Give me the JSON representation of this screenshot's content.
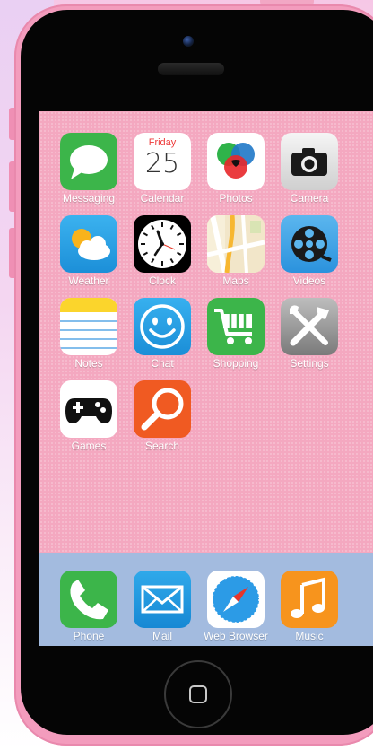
{
  "apps": [
    {
      "label": "Messaging",
      "icon": "message-bubble-icon",
      "color": "#3cb54a"
    },
    {
      "label": "Calendar",
      "icon": "calendar-icon",
      "color": "#ffffff",
      "day": "Friday",
      "date": "25"
    },
    {
      "label": "Photos",
      "icon": "photos-icon",
      "color": "#ffffff"
    },
    {
      "label": "Camera",
      "icon": "camera-icon",
      "color": "#d9d9d9"
    },
    {
      "label": "Weather",
      "icon": "weather-icon",
      "color": "#2aa6e8"
    },
    {
      "label": "Clock",
      "icon": "clock-icon",
      "color": "#000000"
    },
    {
      "label": "Maps",
      "icon": "map-icon",
      "color": "#f3e7c8"
    },
    {
      "label": "Videos",
      "icon": "film-reel-icon",
      "color": "#43a6e9"
    },
    {
      "label": "Notes",
      "icon": "notes-icon",
      "color": "#ffffff"
    },
    {
      "label": "Chat",
      "icon": "smiley-icon",
      "color": "#2aa6e8"
    },
    {
      "label": "Shopping",
      "icon": "shopping-cart-icon",
      "color": "#3cb54a"
    },
    {
      "label": "Settings",
      "icon": "tools-icon",
      "color": "#9a9a9a"
    },
    {
      "label": "Games",
      "icon": "gamepad-icon",
      "color": "#ffffff"
    },
    {
      "label": "Search",
      "icon": "magnifier-icon",
      "color": "#f05a22"
    }
  ],
  "dock": [
    {
      "label": "Phone",
      "icon": "phone-handset-icon",
      "color": "#3cb54a"
    },
    {
      "label": "Mail",
      "icon": "envelope-icon",
      "color": "#1f9fe0"
    },
    {
      "label": "Web Browser",
      "icon": "compass-icon",
      "color": "#ffffff"
    },
    {
      "label": "Music",
      "icon": "music-note-icon",
      "color": "#f7941d"
    }
  ],
  "colors": {
    "shell": "#f39cbd",
    "screen": "#f4a8c0",
    "dock": "#a3bbdf"
  }
}
